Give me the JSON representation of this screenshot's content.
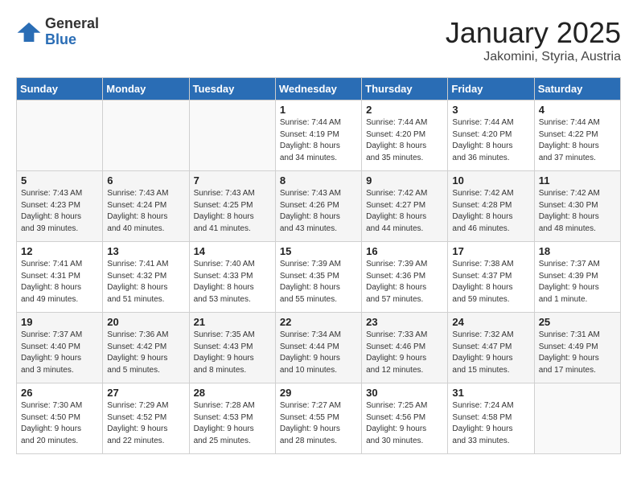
{
  "logo": {
    "general": "General",
    "blue": "Blue"
  },
  "title": "January 2025",
  "subtitle": "Jakomini, Styria, Austria",
  "weekdays": [
    "Sunday",
    "Monday",
    "Tuesday",
    "Wednesday",
    "Thursday",
    "Friday",
    "Saturday"
  ],
  "weeks": [
    [
      {
        "day": "",
        "info": ""
      },
      {
        "day": "",
        "info": ""
      },
      {
        "day": "",
        "info": ""
      },
      {
        "day": "1",
        "info": "Sunrise: 7:44 AM\nSunset: 4:19 PM\nDaylight: 8 hours\nand 34 minutes."
      },
      {
        "day": "2",
        "info": "Sunrise: 7:44 AM\nSunset: 4:20 PM\nDaylight: 8 hours\nand 35 minutes."
      },
      {
        "day": "3",
        "info": "Sunrise: 7:44 AM\nSunset: 4:20 PM\nDaylight: 8 hours\nand 36 minutes."
      },
      {
        "day": "4",
        "info": "Sunrise: 7:44 AM\nSunset: 4:22 PM\nDaylight: 8 hours\nand 37 minutes."
      }
    ],
    [
      {
        "day": "5",
        "info": "Sunrise: 7:43 AM\nSunset: 4:23 PM\nDaylight: 8 hours\nand 39 minutes."
      },
      {
        "day": "6",
        "info": "Sunrise: 7:43 AM\nSunset: 4:24 PM\nDaylight: 8 hours\nand 40 minutes."
      },
      {
        "day": "7",
        "info": "Sunrise: 7:43 AM\nSunset: 4:25 PM\nDaylight: 8 hours\nand 41 minutes."
      },
      {
        "day": "8",
        "info": "Sunrise: 7:43 AM\nSunset: 4:26 PM\nDaylight: 8 hours\nand 43 minutes."
      },
      {
        "day": "9",
        "info": "Sunrise: 7:42 AM\nSunset: 4:27 PM\nDaylight: 8 hours\nand 44 minutes."
      },
      {
        "day": "10",
        "info": "Sunrise: 7:42 AM\nSunset: 4:28 PM\nDaylight: 8 hours\nand 46 minutes."
      },
      {
        "day": "11",
        "info": "Sunrise: 7:42 AM\nSunset: 4:30 PM\nDaylight: 8 hours\nand 48 minutes."
      }
    ],
    [
      {
        "day": "12",
        "info": "Sunrise: 7:41 AM\nSunset: 4:31 PM\nDaylight: 8 hours\nand 49 minutes."
      },
      {
        "day": "13",
        "info": "Sunrise: 7:41 AM\nSunset: 4:32 PM\nDaylight: 8 hours\nand 51 minutes."
      },
      {
        "day": "14",
        "info": "Sunrise: 7:40 AM\nSunset: 4:33 PM\nDaylight: 8 hours\nand 53 minutes."
      },
      {
        "day": "15",
        "info": "Sunrise: 7:39 AM\nSunset: 4:35 PM\nDaylight: 8 hours\nand 55 minutes."
      },
      {
        "day": "16",
        "info": "Sunrise: 7:39 AM\nSunset: 4:36 PM\nDaylight: 8 hours\nand 57 minutes."
      },
      {
        "day": "17",
        "info": "Sunrise: 7:38 AM\nSunset: 4:37 PM\nDaylight: 8 hours\nand 59 minutes."
      },
      {
        "day": "18",
        "info": "Sunrise: 7:37 AM\nSunset: 4:39 PM\nDaylight: 9 hours\nand 1 minute."
      }
    ],
    [
      {
        "day": "19",
        "info": "Sunrise: 7:37 AM\nSunset: 4:40 PM\nDaylight: 9 hours\nand 3 minutes."
      },
      {
        "day": "20",
        "info": "Sunrise: 7:36 AM\nSunset: 4:42 PM\nDaylight: 9 hours\nand 5 minutes."
      },
      {
        "day": "21",
        "info": "Sunrise: 7:35 AM\nSunset: 4:43 PM\nDaylight: 9 hours\nand 8 minutes."
      },
      {
        "day": "22",
        "info": "Sunrise: 7:34 AM\nSunset: 4:44 PM\nDaylight: 9 hours\nand 10 minutes."
      },
      {
        "day": "23",
        "info": "Sunrise: 7:33 AM\nSunset: 4:46 PM\nDaylight: 9 hours\nand 12 minutes."
      },
      {
        "day": "24",
        "info": "Sunrise: 7:32 AM\nSunset: 4:47 PM\nDaylight: 9 hours\nand 15 minutes."
      },
      {
        "day": "25",
        "info": "Sunrise: 7:31 AM\nSunset: 4:49 PM\nDaylight: 9 hours\nand 17 minutes."
      }
    ],
    [
      {
        "day": "26",
        "info": "Sunrise: 7:30 AM\nSunset: 4:50 PM\nDaylight: 9 hours\nand 20 minutes."
      },
      {
        "day": "27",
        "info": "Sunrise: 7:29 AM\nSunset: 4:52 PM\nDaylight: 9 hours\nand 22 minutes."
      },
      {
        "day": "28",
        "info": "Sunrise: 7:28 AM\nSunset: 4:53 PM\nDaylight: 9 hours\nand 25 minutes."
      },
      {
        "day": "29",
        "info": "Sunrise: 7:27 AM\nSunset: 4:55 PM\nDaylight: 9 hours\nand 28 minutes."
      },
      {
        "day": "30",
        "info": "Sunrise: 7:25 AM\nSunset: 4:56 PM\nDaylight: 9 hours\nand 30 minutes."
      },
      {
        "day": "31",
        "info": "Sunrise: 7:24 AM\nSunset: 4:58 PM\nDaylight: 9 hours\nand 33 minutes."
      },
      {
        "day": "",
        "info": ""
      }
    ]
  ]
}
